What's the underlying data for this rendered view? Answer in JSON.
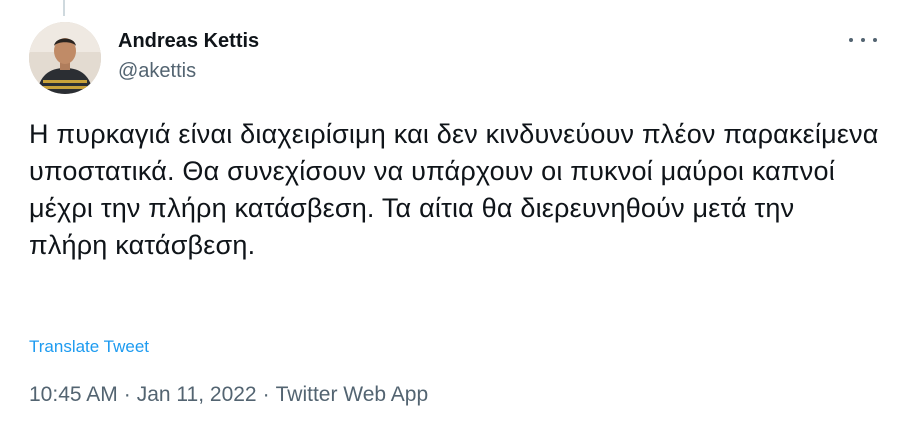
{
  "tweet": {
    "author": {
      "display_name": "Andreas Kettis",
      "handle": "@akettis",
      "avatar_icon": "user-avatar"
    },
    "more_icon": "more-horizontal-icon",
    "text": "Η πυρκαγιά είναι διαχειρίσιμη και δεν κινδυνεύουν πλέον παρακείμενα υποστατικά. Θα συνεχίσουν να υπάρχουν οι πυκνοί μαύροι καπνοί μέχρι την πλήρη κατάσβεση. Τα αίτια θα διερευνηθούν μετά την πλήρη κατάσβεση.",
    "translate_label": "Translate Tweet",
    "time": "10:45 AM",
    "date": "Jan 11, 2022",
    "separator": "·",
    "source": "Twitter Web App"
  },
  "colors": {
    "text_primary": "#0f1419",
    "text_secondary": "#536471",
    "link": "#1d9bf0"
  }
}
